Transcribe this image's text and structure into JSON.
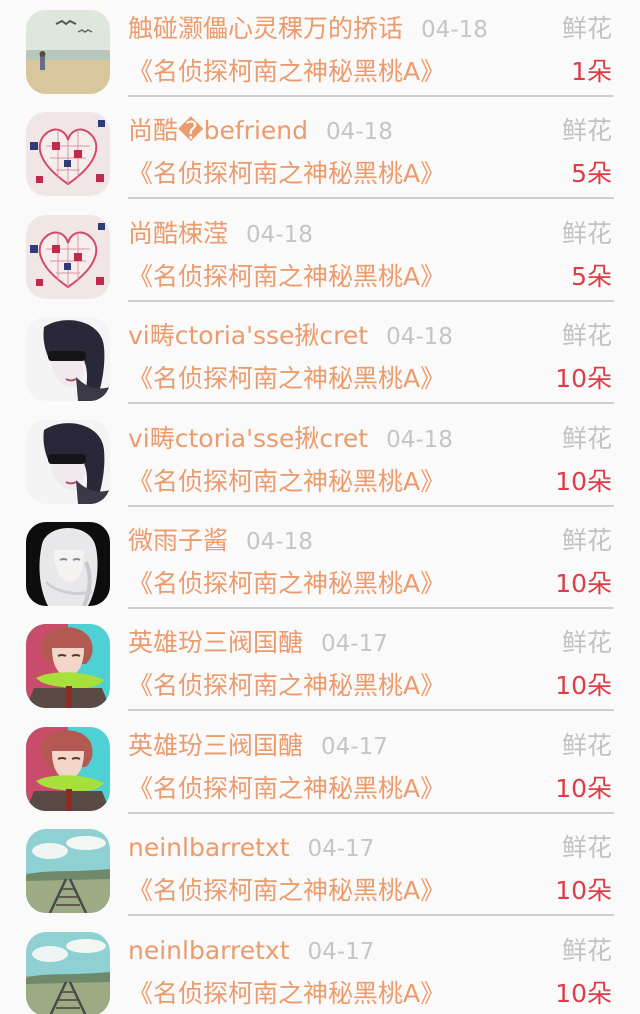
{
  "rows": [
    {
      "name": "触碰灏儡心灵稞万的挢话",
      "date": "04-18",
      "gift_type": "鲜花",
      "title": "《名侦探柯南之神秘黑桃A》",
      "count": "1朵",
      "avatar": "beach-avatar"
    },
    {
      "name": "尚酷�befriend",
      "date": "04-18",
      "gift_type": "鲜花",
      "title": "《名侦探柯南之神秘黑桃A》",
      "count": "5朵",
      "avatar": "puzzle-heart-avatar"
    },
    {
      "name": "尚酷梀滢",
      "date": "04-18",
      "gift_type": "鲜花",
      "title": "《名侦探柯南之神秘黑桃A》",
      "count": "5朵",
      "avatar": "puzzle-heart-avatar"
    },
    {
      "name": "vi畴ctoria'sse揪cret",
      "date": "04-18",
      "gift_type": "鲜花",
      "title": "《名侦探柯南之神秘黑桃A》",
      "count": "10朵",
      "avatar": "sunglasses-girl-avatar"
    },
    {
      "name": "vi畴ctoria'sse揪cret",
      "date": "04-18",
      "gift_type": "鲜花",
      "title": "《名侦探柯南之神秘黑桃A》",
      "count": "10朵",
      "avatar": "sunglasses-girl-avatar"
    },
    {
      "name": "微雨子酱",
      "date": "04-18",
      "gift_type": "鲜花",
      "title": "《名侦探柯南之神秘黑桃A》",
      "count": "10朵",
      "avatar": "white-hair-girl-avatar"
    },
    {
      "name": "英雄玢三阀国醣",
      "date": "04-17",
      "gift_type": "鲜花",
      "title": "《名侦探柯南之神秘黑桃A》",
      "count": "10朵",
      "avatar": "anime-boy-avatar"
    },
    {
      "name": "英雄玢三阀国醣",
      "date": "04-17",
      "gift_type": "鲜花",
      "title": "《名侦探柯南之神秘黑桃A》",
      "count": "10朵",
      "avatar": "anime-boy-avatar"
    },
    {
      "name": "neinlbarretxt",
      "date": "04-17",
      "gift_type": "鲜花",
      "title": "《名侦探柯南之神秘黑桃A》",
      "count": "10朵",
      "avatar": "railway-sky-avatar"
    },
    {
      "name": "neinlbarretxt",
      "date": "04-17",
      "gift_type": "鲜花",
      "title": "《名侦探柯南之神秘黑桃A》",
      "count": "10朵",
      "avatar": "railway-sky-avatar"
    }
  ]
}
